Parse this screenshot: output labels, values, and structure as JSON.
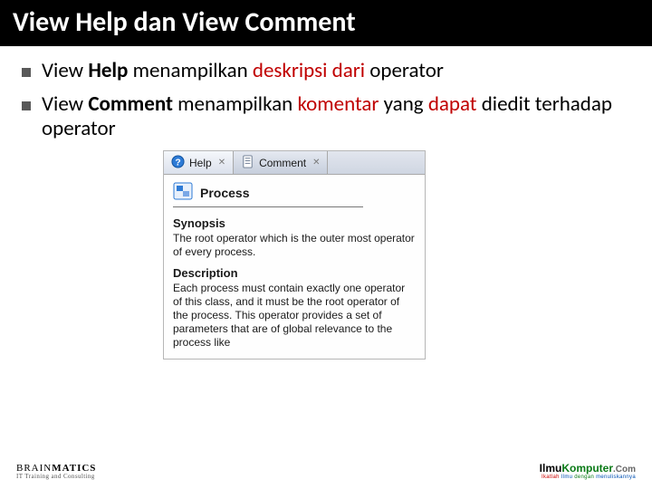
{
  "title": "View Help dan View Comment",
  "bullets": [
    {
      "pre": "View ",
      "bold": "Help",
      "mid": " menampilkan ",
      "mid_red": "deskripsi",
      "mid2": " ",
      "mid2_red": "dari",
      "tail": " operator"
    },
    {
      "pre": "View ",
      "bold": "Comment",
      "mid": " menampilkan ",
      "mid_red": "komentar",
      "mid2": " yang ",
      "mid2_red": "dapat",
      "tail": " diedit terhadap operator"
    }
  ],
  "tabs": {
    "help": "Help",
    "comment": "Comment"
  },
  "panel": {
    "process_label": "Process",
    "synopsis_h": "Synopsis",
    "synopsis_body": "The root operator which is the outer most operator of every process.",
    "description_h": "Description",
    "description_body": "Each process must contain exactly one operator of this class, and it must be the root operator of the process. This operator provides a set of parameters that are of global relevance to the process like"
  },
  "footer": {
    "left_brand_1": "BRAIN",
    "left_brand_2": "MATICS",
    "left_tag": "IT Training and Consulting",
    "right_brand_pre": "Ilmu",
    "right_brand_mid": "Komputer",
    "right_brand_suf": ".Com",
    "right_tag_full": "Ikatlah Ilmu dengan menuliskannya"
  }
}
